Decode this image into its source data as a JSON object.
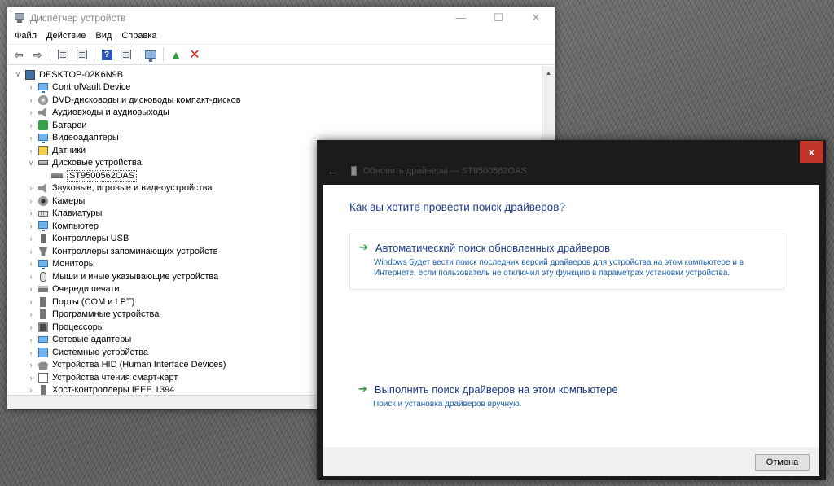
{
  "device_manager": {
    "title": "Диспетчер устройств",
    "window_controls": {
      "minimize": "—",
      "maximize": "☐",
      "close": "✕"
    },
    "menu": [
      "Файл",
      "Действие",
      "Вид",
      "Справка"
    ],
    "tree": {
      "root": "DESKTOP-02K6N9B",
      "items": [
        {
          "label": "ControlVault Device",
          "icon": "monitor-icon"
        },
        {
          "label": "DVD-дисководы и дисководы компакт-дисков",
          "icon": "dvd-icon"
        },
        {
          "label": "Аудиовходы и аудиовыходы",
          "icon": "speaker-icon"
        },
        {
          "label": "Батареи",
          "icon": "battery-icon"
        },
        {
          "label": "Видеоадаптеры",
          "icon": "display-adapter-icon"
        },
        {
          "label": "Датчики",
          "icon": "sensor-icon"
        },
        {
          "label": "Дисковые устройства",
          "icon": "disk-icon",
          "expanded": true,
          "children": [
            {
              "label": "ST9500562OAS"
            }
          ]
        },
        {
          "label": "Звуковые, игровые и видеоустройства",
          "icon": "speaker-icon"
        },
        {
          "label": "Камеры",
          "icon": "camera-icon"
        },
        {
          "label": "Клавиатуры",
          "icon": "keyboard-icon"
        },
        {
          "label": "Компьютер",
          "icon": "computer-icon"
        },
        {
          "label": "Контроллеры USB",
          "icon": "usb-icon"
        },
        {
          "label": "Контроллеры запоминающих устройств",
          "icon": "storage-icon"
        },
        {
          "label": "Мониторы",
          "icon": "monitor-icon"
        },
        {
          "label": "Мыши и иные указывающие устройства",
          "icon": "mouse-icon"
        },
        {
          "label": "Очереди печати",
          "icon": "printer-icon"
        },
        {
          "label": "Порты (COM и LPT)",
          "icon": "port-icon"
        },
        {
          "label": "Программные устройства",
          "icon": "port-icon"
        },
        {
          "label": "Процессоры",
          "icon": "chip-icon"
        },
        {
          "label": "Сетевые адаптеры",
          "icon": "network-icon"
        },
        {
          "label": "Системные устройства",
          "icon": "system-icon"
        },
        {
          "label": "Устройства HID (Human Interface Devices)",
          "icon": "hid-icon"
        },
        {
          "label": "Устройства чтения смарт-карт",
          "icon": "smartcard-icon"
        },
        {
          "label": "Хост-контроллеры IEEE 1394",
          "icon": "ieee1394-icon"
        }
      ]
    }
  },
  "update_dialog": {
    "close_glyph": "x",
    "title": "Обновить драйверы — ST9500562OAS",
    "heading": "Как вы хотите провести поиск драйверов?",
    "option_auto": {
      "title": "Автоматический поиск обновленных драйверов",
      "description": "Windows будет вести поиск последних версий драйверов для устройства на этом компьютере и в Интернете, если пользователь не отключил эту функцию в параметрах установки устройства."
    },
    "option_manual": {
      "title": "Выполнить поиск драйверов на этом компьютере",
      "description": "Поиск и установка драйверов вручную."
    },
    "cancel_label": "Отмена"
  },
  "colors": {
    "accent_link": "#1c3b8a",
    "green_arrow": "#2e9a47",
    "close_red": "#c3352a"
  }
}
